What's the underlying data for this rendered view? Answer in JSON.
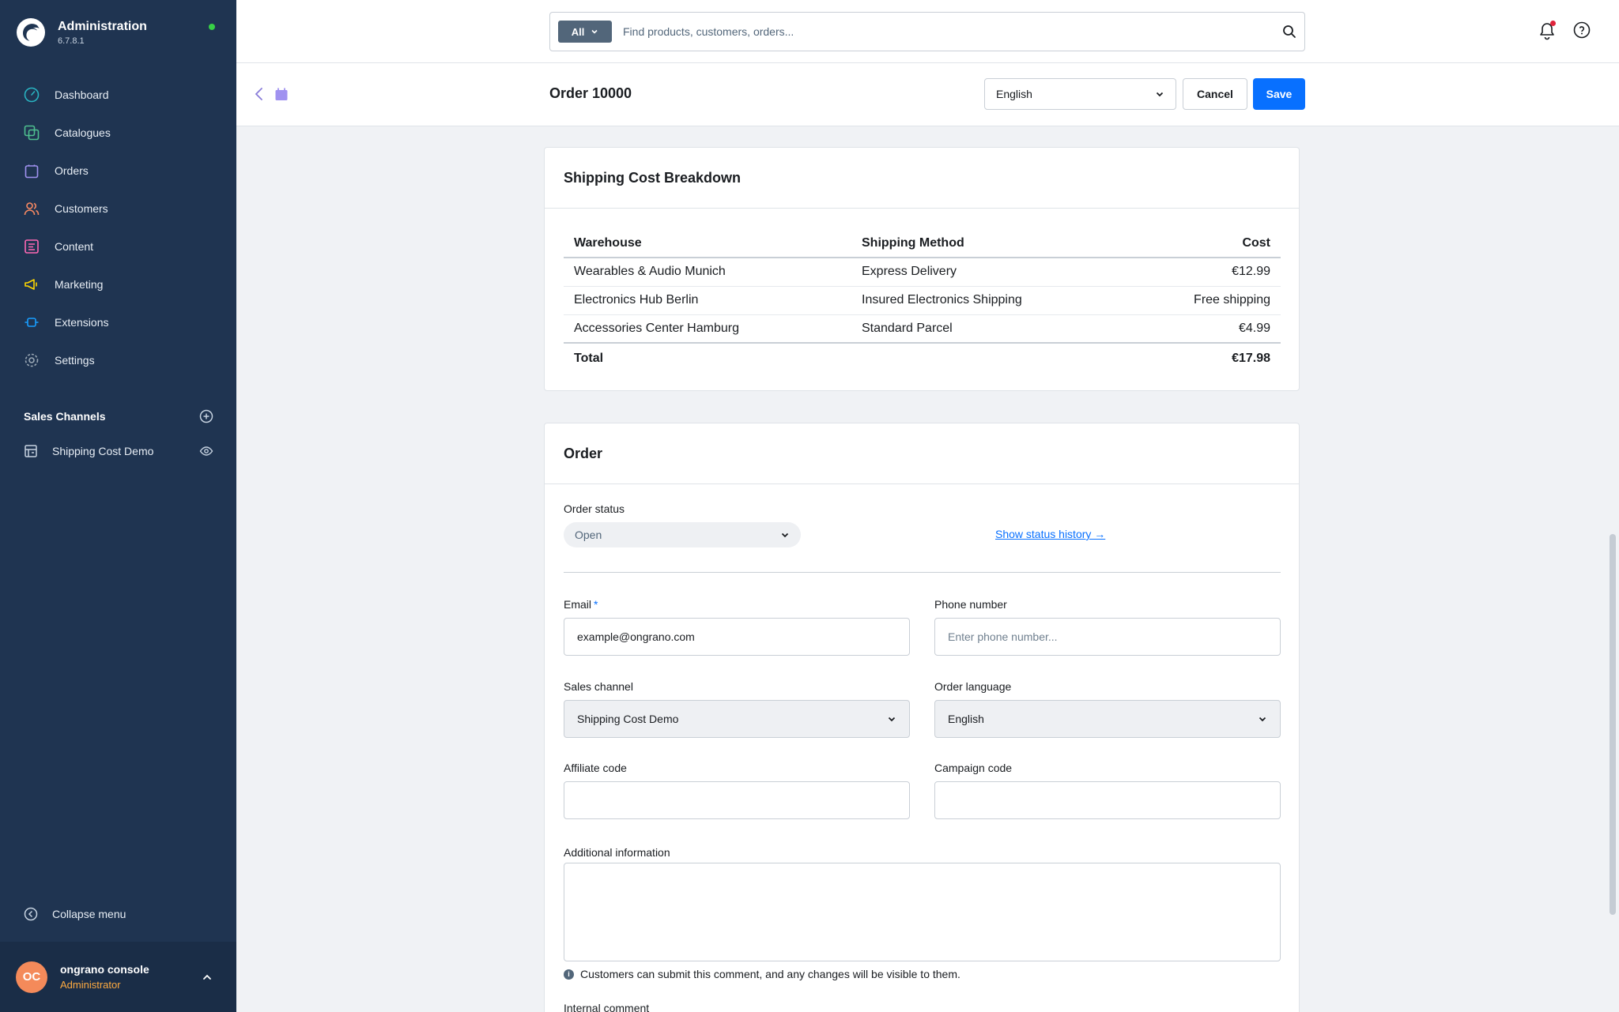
{
  "app": {
    "title": "Administration",
    "version": "6.7.8.1"
  },
  "sidebar": {
    "items": [
      {
        "label": "Dashboard",
        "icon": "dashboard-icon"
      },
      {
        "label": "Catalogues",
        "icon": "catalogues-icon"
      },
      {
        "label": "Orders",
        "icon": "orders-icon"
      },
      {
        "label": "Customers",
        "icon": "customers-icon"
      },
      {
        "label": "Content",
        "icon": "content-icon"
      },
      {
        "label": "Marketing",
        "icon": "marketing-icon"
      },
      {
        "label": "Extensions",
        "icon": "extensions-icon"
      },
      {
        "label": "Settings",
        "icon": "settings-icon"
      }
    ],
    "sales_channels_title": "Sales Channels",
    "sales_channel_item": "Shipping Cost Demo",
    "collapse_label": "Collapse menu",
    "user": {
      "initials": "OC",
      "name": "ongrano console",
      "role": "Administrator"
    }
  },
  "topbar": {
    "search_type": "All",
    "search_placeholder": "Find products, customers, orders..."
  },
  "header": {
    "title": "Order 10000",
    "language": "English",
    "cancel_label": "Cancel",
    "save_label": "Save"
  },
  "shipping": {
    "title": "Shipping Cost Breakdown",
    "headers": [
      "Warehouse",
      "Shipping Method",
      "Cost"
    ],
    "rows": [
      [
        "Wearables & Audio Munich",
        "Express Delivery",
        "€12.99"
      ],
      [
        "Electronics Hub Berlin",
        "Insured Electronics Shipping",
        "Free shipping"
      ],
      [
        "Accessories Center Hamburg",
        "Standard Parcel",
        "€4.99"
      ]
    ],
    "total_label": "Total",
    "total_value": "€17.98"
  },
  "order": {
    "title": "Order",
    "status_label": "Order status",
    "status_value": "Open",
    "status_history_link": "Show status history →",
    "email_label": "Email",
    "email_value": "example@ongrano.com",
    "phone_label": "Phone number",
    "phone_placeholder": "Enter phone number...",
    "sales_channel_label": "Sales channel",
    "sales_channel_value": "Shipping Cost Demo",
    "order_language_label": "Order language",
    "order_language_value": "English",
    "affiliate_label": "Affiliate code",
    "campaign_label": "Campaign code",
    "additional_info_label": "Additional information",
    "hint": "Customers can submit this comment, and any changes will be visible to them.",
    "internal_comment_label": "Internal comment"
  },
  "colors": {
    "sidebar": "#1f3451",
    "accent": "#0870ff",
    "role": "#ffab40"
  }
}
